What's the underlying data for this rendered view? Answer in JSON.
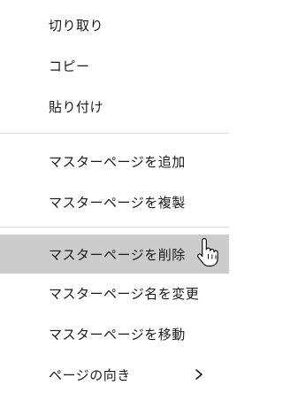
{
  "menu": {
    "items": [
      {
        "label": "切り取り"
      },
      {
        "label": "コピー"
      },
      {
        "label": "貼り付け"
      },
      {
        "label": "マスターページを追加"
      },
      {
        "label": "マスターページを複製"
      },
      {
        "label": "マスターページを削除"
      },
      {
        "label": "マスターページ名を変更"
      },
      {
        "label": "マスターページを移動"
      },
      {
        "label": "ページの向き"
      }
    ],
    "hovered_item": "マスターページを削除",
    "submenu_icon": "chevron-right-icon",
    "cursor_icon": "hand-pointer-icon"
  },
  "colors": {
    "hover_background": "#cccccc",
    "separator": "#d9d9d9",
    "text": "#1a1a1a"
  }
}
